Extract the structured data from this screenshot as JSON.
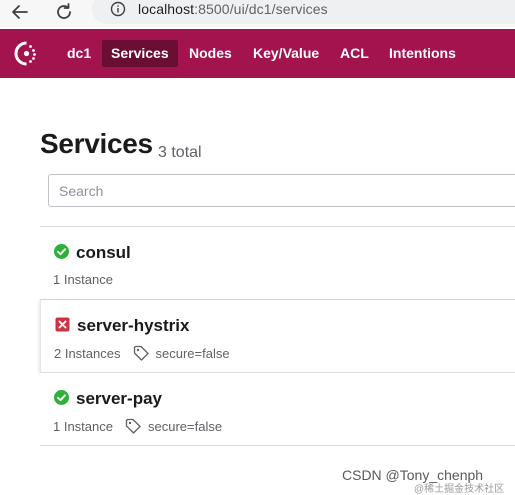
{
  "browser": {
    "url_host": "localhost",
    "url_path": ":8500/ui/dc1/services"
  },
  "nav": {
    "datacenter": "dc1",
    "items": [
      "Services",
      "Nodes",
      "Key/Value",
      "ACL",
      "Intentions"
    ],
    "active": "Services"
  },
  "page": {
    "title": "Services",
    "count": "3 total",
    "search_placeholder": "Search"
  },
  "services": [
    {
      "name": "consul",
      "status": "passing",
      "instances": "1 Instance",
      "tag": ""
    },
    {
      "name": "server-hystrix",
      "status": "critical",
      "instances": "2 Instances",
      "tag": "secure=false"
    },
    {
      "name": "server-pay",
      "status": "passing",
      "instances": "1 Instance",
      "tag": "secure=false"
    }
  ],
  "watermark": "CSDN @Tony_chenph",
  "watermark_small": "@稀土掘金技术社区",
  "colors": {
    "brand": "#a3134e",
    "active_nav": "#6b0e33",
    "passing": "#2eb039",
    "critical": "#c73445"
  },
  "icons": {
    "back": "arrow-left",
    "reload": "reload",
    "info": "info-circle",
    "logo": "consul-logo",
    "tag": "tag",
    "passing": "check-circle",
    "critical": "x-square"
  }
}
